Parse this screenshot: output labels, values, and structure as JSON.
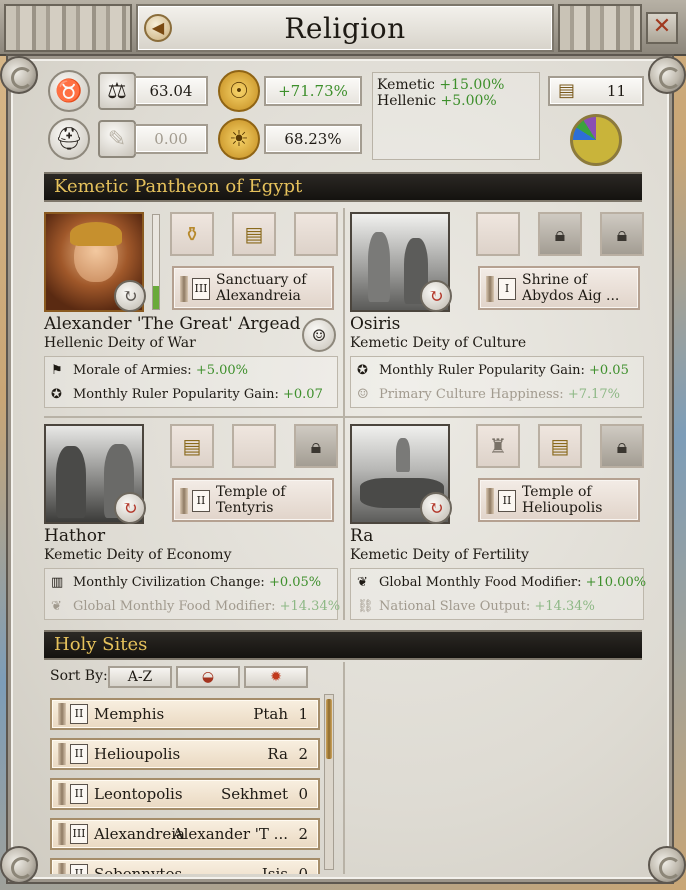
{
  "window": {
    "title": "Religion"
  },
  "stats": {
    "stability_value": "63.04",
    "tyranny_value": "0.00",
    "omen_power": "+71.73%",
    "religious_unity": "68.23%",
    "religions": [
      {
        "name": "Kemetic",
        "value": "+15.00%"
      },
      {
        "name": "Hellenic",
        "value": "+5.00%"
      }
    ],
    "treasury_count": "11"
  },
  "pantheon": {
    "title": "Kemetic Pantheon of Egypt",
    "deities": [
      {
        "name": "Alexander 'The Great' Argead",
        "role": "Hellenic Deity of War",
        "temple": {
          "rank": "III",
          "name": "Sanctuary of Alexandreia"
        },
        "modifiers": [
          {
            "label": "Morale of Armies:",
            "value": "+5.00%",
            "active": true
          },
          {
            "label": "Monthly Ruler Popularity Gain:",
            "value": "+0.07",
            "active": true
          }
        ]
      },
      {
        "name": "Osiris",
        "role": "Kemetic Deity of Culture",
        "temple": {
          "rank": "I",
          "name": "Shrine of Abydos Aig ..."
        },
        "modifiers": [
          {
            "label": "Monthly Ruler Popularity Gain:",
            "value": "+0.05",
            "active": true
          },
          {
            "label": "Primary Culture Happiness:",
            "value": "+7.17%",
            "active": false
          }
        ]
      },
      {
        "name": "Hathor",
        "role": "Kemetic Deity of Economy",
        "temple": {
          "rank": "II",
          "name": "Temple of Tentyris"
        },
        "modifiers": [
          {
            "label": "Monthly Civilization Change:",
            "value": "+0.05%",
            "active": true
          },
          {
            "label": "Global Monthly Food Modifier:",
            "value": "+14.34%",
            "active": false
          }
        ]
      },
      {
        "name": "Ra",
        "role": "Kemetic Deity of Fertility",
        "temple": {
          "rank": "II",
          "name": "Temple of Helioupolis"
        },
        "modifiers": [
          {
            "label": "Global Monthly Food Modifier:",
            "value": "+10.00%",
            "active": true
          },
          {
            "label": "National Slave Output:",
            "value": "+14.34%",
            "active": false
          }
        ]
      }
    ]
  },
  "holy_sites": {
    "title": "Holy Sites",
    "sort_label": "Sort By:",
    "sort_options": [
      "A-Z"
    ],
    "rows": [
      {
        "rank": "II",
        "name": "Memphis",
        "deity": "Ptah",
        "count": "1"
      },
      {
        "rank": "II",
        "name": "Helioupolis",
        "deity": "Ra",
        "count": "2"
      },
      {
        "rank": "II",
        "name": "Leontopolis",
        "deity": "Sekhmet",
        "count": "0"
      },
      {
        "rank": "III",
        "name": "Alexandreia",
        "deity": "Alexander 'T ...",
        "count": "2"
      },
      {
        "rank": "II",
        "name": "Sebennytos",
        "deity": "Isis",
        "count": "0"
      }
    ]
  },
  "colors": {
    "positive": "#3d8f2b",
    "section_title": "#e6c25c",
    "refresh_red": "#b3372a"
  }
}
